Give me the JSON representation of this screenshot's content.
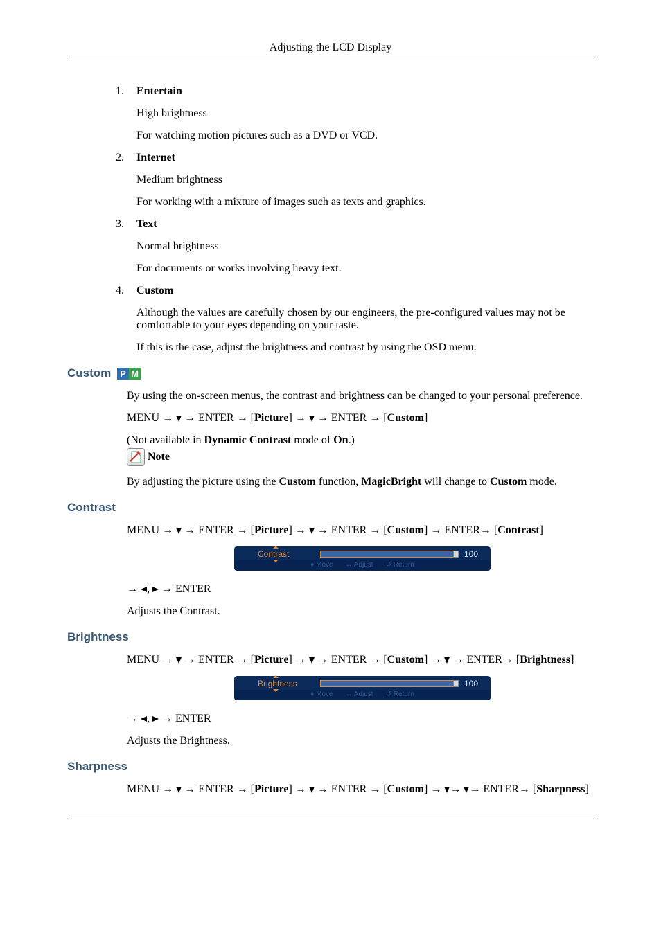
{
  "header": {
    "title": "Adjusting the LCD Display"
  },
  "modes": [
    {
      "title": "Entertain",
      "lines": [
        "High brightness",
        "For watching motion pictures such as a DVD or VCD."
      ]
    },
    {
      "title": "Internet",
      "lines": [
        "Medium brightness",
        "For working with a mixture of images such as texts and graphics."
      ]
    },
    {
      "title": "Text",
      "lines": [
        "Normal brightness",
        "For documents or works involving heavy text."
      ]
    },
    {
      "title": "Custom",
      "lines": [
        "Although the values are carefully chosen by our engineers, the pre-configured values may not be comfortable to your eyes depending on your taste.",
        "If this is the case, adjust the brightness and contrast by using the OSD menu."
      ]
    }
  ],
  "pm": {
    "p": "P",
    "m": "M",
    "p_bg": "#2f6fb3",
    "m_bg": "#3aa24a"
  },
  "custom_section": {
    "heading": "Custom",
    "intro": "By using the on-screen menus, the contrast and brightness can be changed to your personal preference.",
    "path_prefix": "MENU → ",
    "path_mid1": " → ENTER → [",
    "path_picture": "Picture",
    "path_mid2": "] → ",
    "path_mid3": " → ENTER → [",
    "path_custom": "Custom",
    "path_end": "]",
    "not_available_pre": "(Not available in ",
    "dyn": "Dynamic Contrast",
    "not_available_mid": " mode of ",
    "on": "On",
    "not_available_post": ".)",
    "note_label": "Note",
    "note_body_pre": "By adjusting the picture using the ",
    "note_b1": "Custom",
    "note_body_mid": " function, ",
    "note_b2": "MagicBright",
    "note_body_mid2": " will change to ",
    "note_b3": "Custom",
    "note_body_post": " mode."
  },
  "contrast": {
    "heading": "Contrast",
    "menu": "MENU",
    "enter": "ENTER",
    "picture": "Picture",
    "custom": "Custom",
    "target": "Contrast",
    "osd_label": "Contrast",
    "osd_value": "100",
    "hint_move": "Move",
    "hint_adjust": "Adjust",
    "hint_return": "Return",
    "tail_enter": "ENTER",
    "desc": "Adjusts the Contrast."
  },
  "brightness": {
    "heading": "Brightness",
    "menu": "MENU",
    "enter": "ENTER",
    "picture": "Picture",
    "custom": "Custom",
    "target": "Brightness",
    "osd_label": "Brightness",
    "osd_value": "100",
    "hint_move": "Move",
    "hint_adjust": "Adjust",
    "hint_return": "Return",
    "tail_enter": "ENTER",
    "desc": "Adjusts the Brightness."
  },
  "sharpness": {
    "heading": "Sharpness",
    "menu": "MENU",
    "enter": "ENTER",
    "picture": "Picture",
    "custom": "Custom",
    "target": "Sharpness"
  }
}
